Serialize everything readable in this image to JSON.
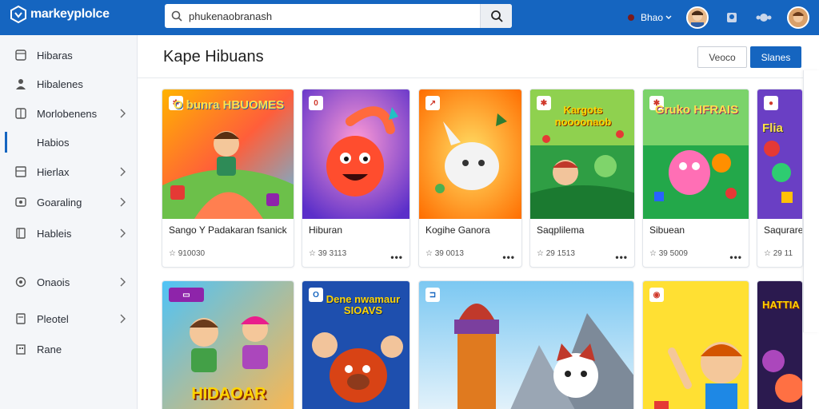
{
  "app": {
    "name": "markeyplolce",
    "brand_color": "#1565c0"
  },
  "search": {
    "value": "phukenaobranash",
    "placeholder": ""
  },
  "topbar": {
    "user_label": "Bhao",
    "icons": [
      "notification-dot",
      "avatar",
      "badge-icon",
      "network-icon",
      "avatar"
    ]
  },
  "sidebar": {
    "items": [
      {
        "label": "Hibaras",
        "icon": "layers-icon",
        "chevron": false,
        "active": false
      },
      {
        "label": "Hibalenes",
        "icon": "user-icon",
        "chevron": false,
        "active": false
      },
      {
        "label": "Morlobenens",
        "icon": "grid-icon",
        "chevron": true,
        "active": false
      },
      {
        "label": "Habios",
        "icon": "list-icon",
        "chevron": false,
        "active": true
      },
      {
        "label": "Hierlax",
        "icon": "table-icon",
        "chevron": true,
        "active": false
      },
      {
        "label": "Goaraling",
        "icon": "gamepad-icon",
        "chevron": true,
        "active": false
      },
      {
        "label": "Hableis",
        "icon": "book-icon",
        "chevron": true,
        "active": false
      },
      {
        "label": "Onaois",
        "icon": "settings-icon",
        "chevron": true,
        "active": false
      },
      {
        "label": "Pleotel",
        "icon": "file-icon",
        "chevron": true,
        "active": false
      },
      {
        "label": "Rane",
        "icon": "building-icon",
        "chevron": false,
        "active": false
      }
    ]
  },
  "main": {
    "title": "Kape Hibuans",
    "secondary_button": "Veoco",
    "primary_button": "Slanes"
  },
  "cards": [
    {
      "title": "Sango Y Padakaran fsanick",
      "meta": "☆ 910030",
      "more": "",
      "headline": "O bunra HBUOMES"
    },
    {
      "title": "Hiburan",
      "meta": "☆ 39 3113",
      "more": "•••",
      "headline": ""
    },
    {
      "title": "Kogihe Ganora",
      "meta": "☆ 39 0013",
      "more": "•••",
      "headline": ""
    },
    {
      "title": "Saqplilema",
      "meta": "☆ 29 1513",
      "more": "•••",
      "headline": "Kargots noooonaob"
    },
    {
      "title": "Sibuean",
      "meta": "☆ 39 5009",
      "more": "•••",
      "headline": "Gruko HFRAIS"
    },
    {
      "title": "Saqurare",
      "meta": "☆ 29 11",
      "more": "•••",
      "headline": "Flia"
    },
    {
      "title": "",
      "meta": "",
      "more": "",
      "headline": "HIDAOAR"
    },
    {
      "title": "",
      "meta": "",
      "more": "",
      "headline": "Dene nwamaur SIOAVS"
    },
    {
      "title": "",
      "meta": "",
      "more": "",
      "headline": ""
    },
    {
      "title": "",
      "meta": "",
      "more": "",
      "headline": ""
    },
    {
      "title": "",
      "meta": "",
      "more": "",
      "headline": "HATTIA"
    }
  ]
}
